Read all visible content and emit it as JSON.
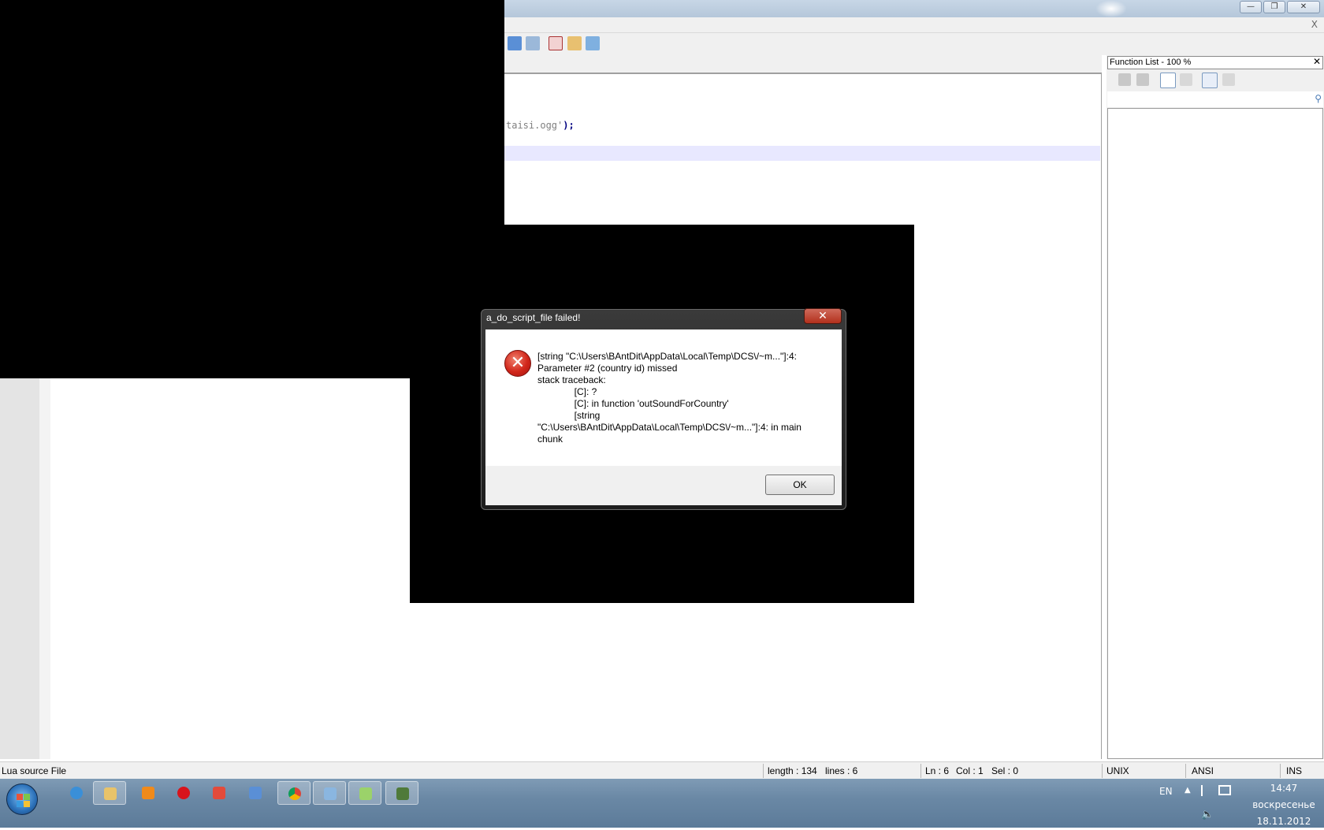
{
  "window": {
    "minimize_glyph": "—",
    "maximize_glyph": "❐",
    "close_glyph": "✕",
    "menu_close_glyph": "X"
  },
  "editor": {
    "visible_code_fragment": "taisi.ogg'",
    "visible_code_tail": ");"
  },
  "function_list": {
    "title": "Function List - 100 %",
    "close_glyph": "✕"
  },
  "status_bar": {
    "file_type": "Lua source File",
    "length": "length : 134",
    "lines": "lines : 6",
    "line": "Ln : 6",
    "column": "Col : 1",
    "selection": "Sel : 0",
    "eol": "UNIX",
    "encoding": "ANSI",
    "mode": "INS"
  },
  "dialog": {
    "title": "a_do_script_file failed!",
    "close_glyph": "✕",
    "message": "[string \"C:\\Users\\BAntDit\\AppData\\Local\\Temp\\DCS\\/~m...\"]:4:\nParameter #2 (country id) missed\nstack traceback:\n              [C]: ?\n              [C]: in function 'outSoundForCountry'\n              [string\n\"C:\\Users\\BAntDit\\AppData\\Local\\Temp\\DCS\\/~m...\"]:4: in main\nchunk",
    "ok_label": "OK",
    "icon": "error-icon",
    "icon_glyph": "✕"
  },
  "taskbar": {
    "language": "EN",
    "time": "14:47",
    "weekday": "воскресенье",
    "date": "18.11.2012",
    "apps": [
      "internet-explorer",
      "explorer",
      "media-player",
      "opera",
      "yandex-browser",
      "mail",
      "chrome",
      "paint",
      "notepadpp",
      "dcs"
    ]
  },
  "colors": {
    "dialog_frame": "#2a2a2a",
    "error_red": "#d1261a",
    "current_line": "#e8e8ff",
    "taskbar": "#6a88a5"
  }
}
